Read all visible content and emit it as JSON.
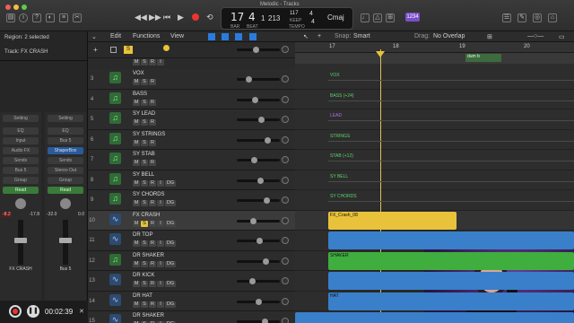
{
  "window": {
    "title": "Melodic - Tracks"
  },
  "lcd": {
    "bar": "17",
    "beat": "4",
    "sub": "1",
    "tick": "213",
    "tempo": "117",
    "tempo_label": "KEEP",
    "sig_top": "4",
    "sig_bot": "4",
    "key": "Cmaj",
    "bar_label": "BAR",
    "beat_label": "BEAT",
    "tempo_unit": "TEMPO",
    "badge": "1234"
  },
  "inspector": {
    "region": "Region: 2 selected",
    "track": "Track: FX CRASH",
    "strip1": {
      "setting": "Setting",
      "eq": "EQ",
      "input": "Input",
      "fx": "Audio FX",
      "sends": "Sends",
      "bus": "Bus 5",
      "group": "Group",
      "read": "Read",
      "val1": "-8.2",
      "val2": "-17.8",
      "name": "FX CRASH"
    },
    "strip2": {
      "setting": "Setting",
      "eq": "EQ",
      "input": "Bus 5",
      "fx": "ShaperBox",
      "sends": "Sends",
      "bus": "Stereo Out",
      "group": "Group",
      "read": "Read",
      "val1": "-32.0",
      "val2": "0.0",
      "name": "Bus 5"
    },
    "time": "00:02:39"
  },
  "toolbar": {
    "edit": "Edit",
    "functions": "Functions",
    "view": "View",
    "snap_label": "Snap:",
    "snap_value": "Smart",
    "drag_label": "Drag:",
    "drag_value": "No Overlap",
    "s_label": "S"
  },
  "ruler": {
    "m17": "17",
    "m18": "18",
    "m19": "19",
    "m20": "20"
  },
  "tracks": [
    {
      "num": "3",
      "name": "VOX",
      "kind": "inst",
      "btns": "M S R"
    },
    {
      "num": "4",
      "name": "BASS",
      "kind": "inst",
      "btns": "M S R"
    },
    {
      "num": "5",
      "name": "SY LEAD",
      "kind": "inst",
      "btns": "M S R"
    },
    {
      "num": "6",
      "name": "SY STRINGS",
      "kind": "inst",
      "btns": "M S R"
    },
    {
      "num": "7",
      "name": "SY STAB",
      "kind": "inst",
      "btns": "M S R"
    },
    {
      "num": "8",
      "name": "SY BELL",
      "kind": "inst",
      "btns": "M S R I DG"
    },
    {
      "num": "9",
      "name": "SY CHORDS",
      "kind": "inst",
      "btns": "M S R I DG"
    },
    {
      "num": "10",
      "name": "FX CRASH",
      "kind": "audio",
      "btns": "M S R I DG"
    },
    {
      "num": "11",
      "name": "DR TOP",
      "kind": "audio",
      "btns": "M S R I DG"
    },
    {
      "num": "12",
      "name": "DR SHAKER",
      "kind": "inst",
      "btns": "M S R I DG"
    },
    {
      "num": "13",
      "name": "DR KICK",
      "kind": "audio",
      "btns": "M S R I DG"
    },
    {
      "num": "14",
      "name": "DR HAT",
      "kind": "audio",
      "btns": "M S R I DG"
    },
    {
      "num": "15",
      "name": "DR SHAKER",
      "kind": "audio",
      "btns": "M S R I DG"
    }
  ],
  "regions": {
    "top_label": "dum b",
    "vox": "VOX",
    "bass": "BASS (+24)",
    "lead": "LEAD",
    "strings": "STRINGS",
    "stab": "STAB (+12)",
    "bell": "SY BELL",
    "chords": "SY CHORDS",
    "crash": "FX_Crash_08",
    "shaker": "SHAKER",
    "hat": "HAT"
  },
  "colors": {
    "accent": "#2a7bde",
    "region_yellow": "#e8c23a",
    "region_green": "#3fae3f",
    "region_blue": "#3a7fc9",
    "lane_label": "#5ed36a"
  }
}
